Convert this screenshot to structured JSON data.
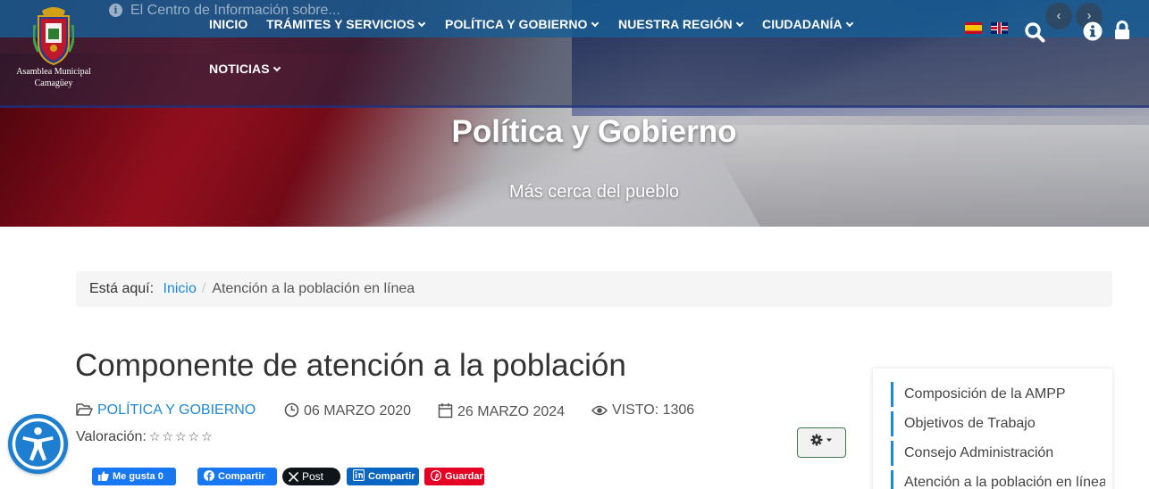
{
  "header": {
    "logo_text_line1": "Asamblea Municipal",
    "logo_text_line2": "Camagüey",
    "ticker": "El Centro de Información sobre...",
    "nav": [
      {
        "label": "INICIO",
        "has_caret": false
      },
      {
        "label": "TRÁMITES Y SERVICIOS",
        "has_caret": true
      },
      {
        "label": "POLÍTICA Y GOBIERNO",
        "has_caret": true
      },
      {
        "label": "NUESTRA REGIÓN",
        "has_caret": true
      },
      {
        "label": "CIUDADANÍA",
        "has_caret": true
      },
      {
        "label": "NOTICIAS",
        "has_caret": true
      }
    ],
    "languages": [
      "es",
      "en"
    ],
    "slider_prev": "‹",
    "slider_next": "›",
    "icons": [
      "search-icon",
      "info-icon",
      "lock-icon"
    ]
  },
  "hero": {
    "title": "Política y Gobierno",
    "subtitle": "Más cerca del pueblo"
  },
  "breadcrumb": {
    "prefix": "Está aquí:",
    "home": "Inicio",
    "separator": "/",
    "current": "Atención a la población en línea"
  },
  "article": {
    "title": "Componente de atención a la población",
    "category": "POLÍTICA Y GOBIERNO",
    "published": "06 MARZO 2020",
    "modified": "26 MARZO 2024",
    "hits": "VISTO: 1306",
    "rating_label": "Valoración:",
    "stars": "☆☆☆☆☆"
  },
  "share": {
    "like": "Me gusta 0",
    "facebook": "Compartir",
    "x": "Post",
    "linkedin": "Compartir",
    "pinterest": "Guardar"
  },
  "sidebar": {
    "items": [
      "Composición de la AMPP",
      "Objetivos de Trabajo",
      "Consejo Administración",
      "Atención a la población en línea"
    ]
  },
  "colors": {
    "topbar": "#18588c",
    "link": "#1e88d6",
    "accessibility": "#1e7fd0"
  }
}
